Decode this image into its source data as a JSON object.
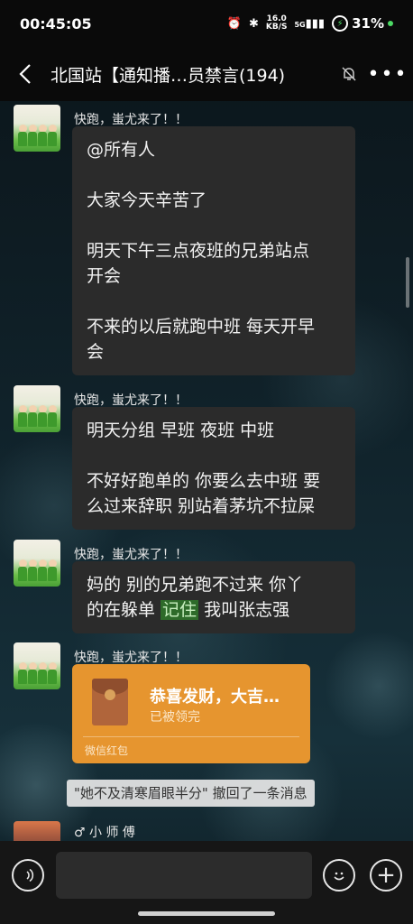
{
  "status_bar": {
    "time": "00:45:05",
    "speed_value": "16.0",
    "speed_unit": "KB/S",
    "signal": "5G",
    "battery": "31%"
  },
  "nav": {
    "title": "北国站【通知播…员禁言(194)"
  },
  "messages": [
    {
      "sender": "快跑，蚩尤来了！！",
      "lines": [
        "@所有人",
        "",
        "大家今天辛苦了",
        "",
        "明天下午三点夜班的兄弟站点",
        "开会",
        "",
        "不来的以后就跑中班 每天开早",
        "会"
      ]
    },
    {
      "sender": "快跑，蚩尤来了！！",
      "lines": [
        "明天分组 早班 夜班 中班",
        "",
        "不好好跑单的 你要么去中班 要",
        "么过来辞职 别站着茅坑不拉屎"
      ]
    },
    {
      "sender": "快跑，蚩尤来了！！",
      "line1": "妈的 别的兄弟跑不过来  你丫",
      "line2_pre": "的在躲单 ",
      "line2_hl": "记住",
      "line2_post": " 我叫张志强"
    },
    {
      "sender": "快跑，蚩尤来了！！",
      "red_packet": {
        "title": "恭喜发财，大吉…",
        "status": "已被领完",
        "label": "微信红包"
      }
    }
  ],
  "system_notice": "\"她不及清寒眉眼半分\" 撤回了一条消息",
  "last_sender": "小 师 傅",
  "icons": {
    "back": "chevron-left-icon",
    "mute": "bell-off-icon",
    "more": "more-icon",
    "voice": "voice-icon",
    "emoji": "emoji-icon",
    "plus": "plus-icon"
  },
  "colors": {
    "red_packet": "#e6952f",
    "highlight": "#2e6b2a",
    "bubble": "#2b2b2b"
  }
}
